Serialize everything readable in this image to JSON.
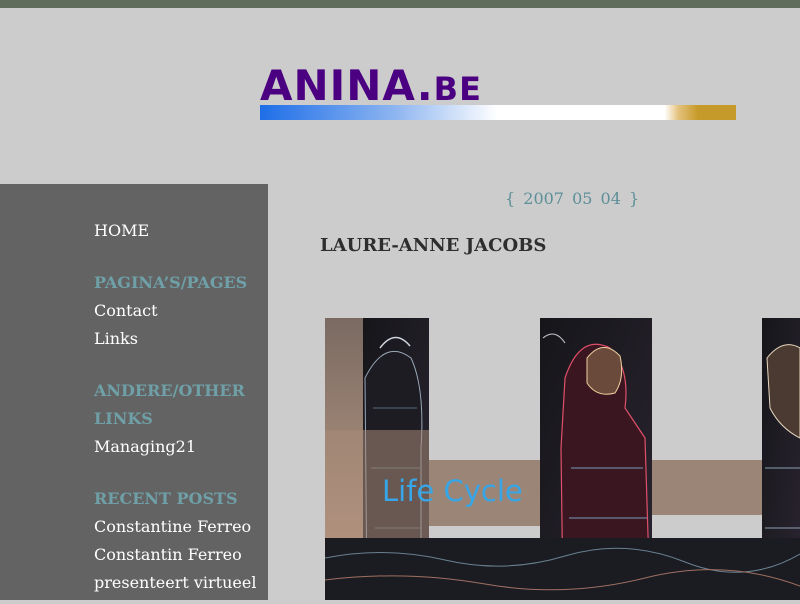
{
  "header": {
    "logo_main": "ANINA.",
    "logo_suffix": "BE"
  },
  "colors": {
    "topbar": "#5f6b5b",
    "background": "#cccccc",
    "sidebar": "#636363",
    "logo_text": "#4b0082",
    "heading_accent": "#6fa0a8",
    "date_accent": "#5d8f99"
  },
  "sidebar": {
    "home": "HOME",
    "pages_heading": "PAGINA’S/PAGES",
    "pages": [
      "Contact",
      "Links"
    ],
    "other_links_heading_line1": "ANDERE/OTHER",
    "other_links_heading_line2": "LINKS",
    "other_links": [
      "Managing21"
    ],
    "recent_posts_heading": "RECENT POSTS",
    "recent_posts": [
      "Constantine Ferreo",
      "Constantin Ferreo",
      "presenteert virtueel"
    ]
  },
  "post": {
    "date": "{ 2007 05 04 }",
    "title": "LAURE-ANNE JACOBS",
    "image_caption": "Life Cycle"
  }
}
